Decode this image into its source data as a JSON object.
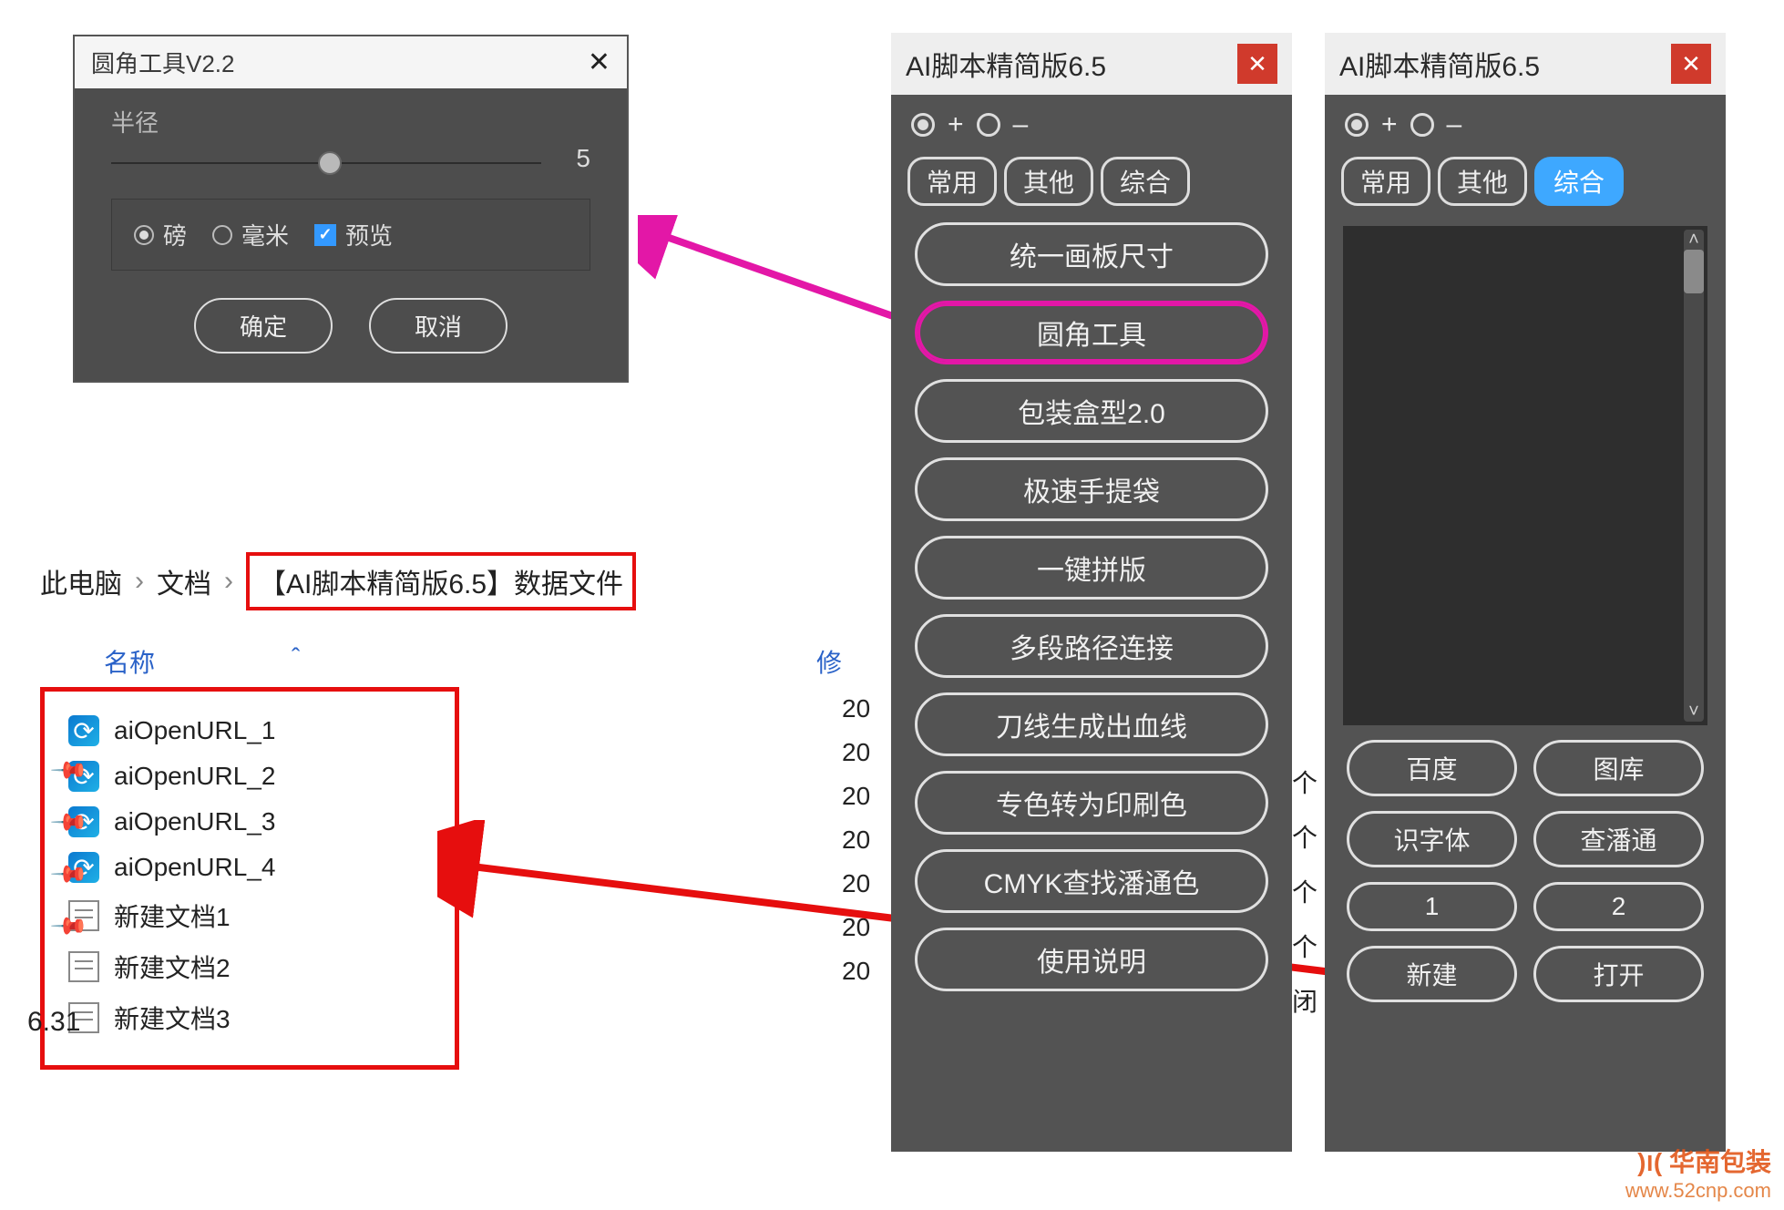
{
  "dialog": {
    "title": "圆角工具V2.2",
    "close": "✕",
    "radius_label": "半径",
    "radius_value": "5",
    "unit1": "磅",
    "unit2": "毫米",
    "preview": "预览",
    "ok": "确定",
    "cancel": "取消"
  },
  "explorer": {
    "bc1": "此电脑",
    "bc2": "文档",
    "bc3": "【AI脚本精简版6.5】数据文件",
    "sep": "›",
    "col_name": "名称",
    "col_sort": "ˆ",
    "col_mod": "修",
    "ver_side": "6.31",
    "files": [
      {
        "name": "aiOpenURL_1",
        "kind": "edge",
        "mod": "20"
      },
      {
        "name": "aiOpenURL_2",
        "kind": "edge",
        "mod": "20"
      },
      {
        "name": "aiOpenURL_3",
        "kind": "edge",
        "mod": "20"
      },
      {
        "name": "aiOpenURL_4",
        "kind": "edge",
        "mod": "20"
      },
      {
        "name": "新建文档1",
        "kind": "doc",
        "mod": "20"
      },
      {
        "name": "新建文档2",
        "kind": "doc",
        "mod": "20"
      },
      {
        "name": "新建文档3",
        "kind": "doc",
        "mod": "20"
      }
    ]
  },
  "panel_a": {
    "title": "AI脚本精简版6.5",
    "close": "✕",
    "plus": "+",
    "minus": "–",
    "tabs": [
      "常用",
      "其他",
      "综合"
    ],
    "tools": [
      "统一画板尺寸",
      "圆角工具",
      "包装盒型2.0",
      "极速手提袋",
      "一键拼版",
      "多段路径连接",
      "刀线生成出血线",
      "专色转为印刷色",
      "CMYK查找潘通色",
      "使用说明"
    ]
  },
  "panel_b": {
    "title": "AI脚本精简版6.5",
    "close": "✕",
    "plus": "+",
    "minus": "–",
    "tabs": [
      "常用",
      "其他",
      "综合"
    ],
    "grid": [
      "百度",
      "图库",
      "识字体",
      "查潘通",
      "1",
      "2",
      "新建",
      "打开"
    ]
  },
  "side_letters": [
    "个",
    "个",
    "个",
    "个",
    "闭"
  ],
  "watermark": {
    "logo": ")ו( 华南包装",
    "url": "www.52cnp.com"
  }
}
